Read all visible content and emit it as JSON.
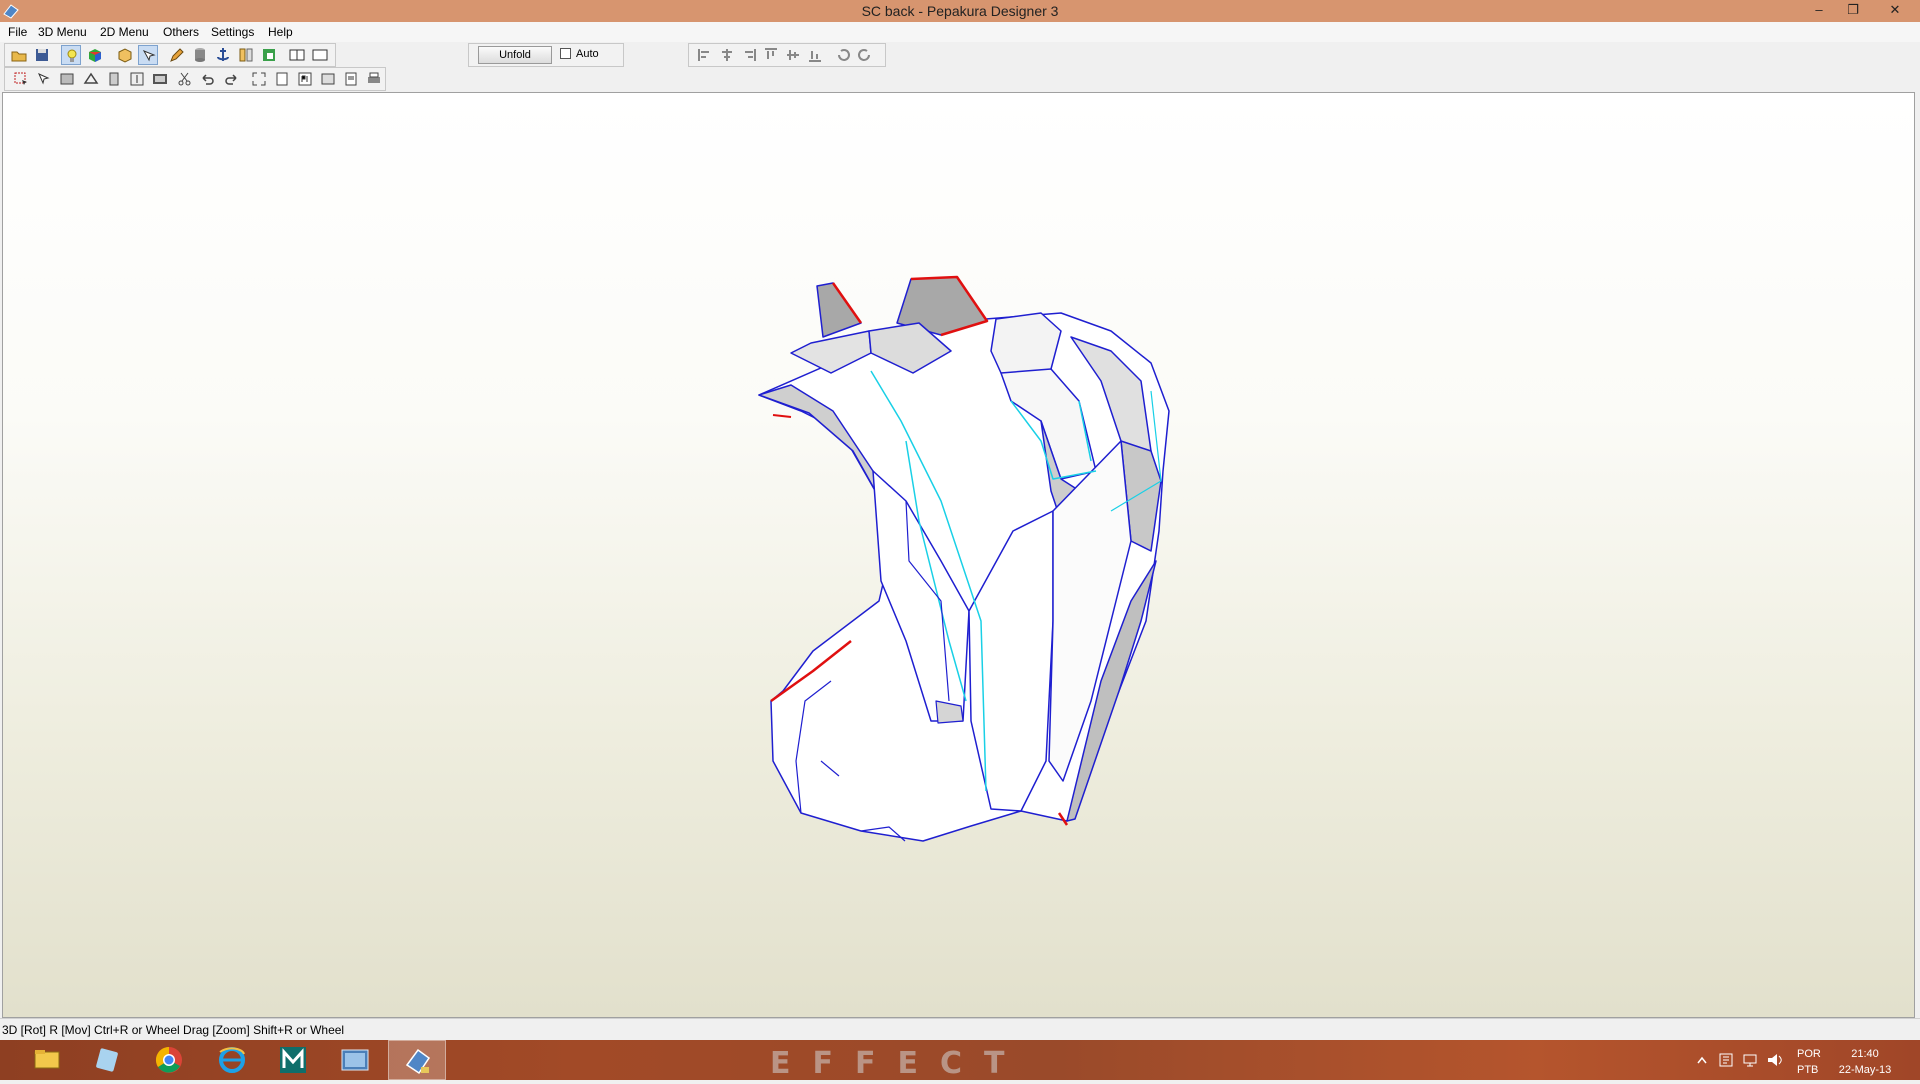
{
  "window": {
    "title": "SC back - Pepakura Designer 3",
    "minimize_glyph": "–",
    "restore_glyph": "❐",
    "close_glyph": "✕"
  },
  "menu": [
    "File",
    "3D Menu",
    "2D Menu",
    "Others",
    "Settings",
    "Help"
  ],
  "toolbar": {
    "unfold_label": "Unfold",
    "auto_label": "Auto",
    "auto_checked": false
  },
  "status": {
    "text": "3D [Rot] R [Mov] Ctrl+R or Wheel Drag [Zoom] Shift+R or Wheel"
  },
  "taskbar": {
    "wallpaper_text": "EFFECT",
    "apps": [
      "file-explorer-icon",
      "internet-explorer-icon",
      "chrome-icon",
      "internet-explorer-icon",
      "maya-icon",
      "photo-viewer-icon",
      "pepakura-icon"
    ],
    "tray": {
      "lang_line1": "POR",
      "lang_line2": "PTB",
      "time": "21:40",
      "date": "22-May-13"
    }
  },
  "colors": {
    "titlebar": "#d7956f",
    "edge_blue": "#1f1fd0",
    "edge_cyan": "#19d0e6",
    "edge_red": "#e01010"
  }
}
